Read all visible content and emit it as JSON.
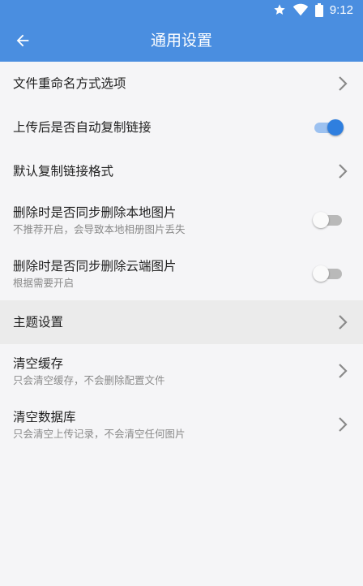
{
  "status_bar": {
    "time": "9:12",
    "icons": [
      "star-icon",
      "wifi-icon",
      "battery-icon"
    ]
  },
  "app_bar": {
    "title": "通用设置",
    "back_icon": "arrow-left-icon"
  },
  "colors": {
    "primary": "#4a8ee0",
    "switch_on": "#2f7fdf",
    "switch_off": "#b9b9b9"
  },
  "settings": {
    "rename_option": {
      "title": "文件重命名方式选项"
    },
    "auto_copy_link": {
      "title": "上传后是否自动复制链接",
      "enabled": true
    },
    "default_link_format": {
      "title": "默认复制链接格式"
    },
    "delete_local_image": {
      "title": "删除时是否同步删除本地图片",
      "subtitle": "不推荐开启，会导致本地相册图片丢失",
      "enabled": false
    },
    "delete_cloud_image": {
      "title": "删除时是否同步删除云端图片",
      "subtitle": "根据需要开启",
      "enabled": false
    },
    "theme": {
      "title": "主题设置"
    },
    "clear_cache": {
      "title": "清空缓存",
      "subtitle": "只会清空缓存，不会删除配置文件"
    },
    "clear_database": {
      "title": "清空数据库",
      "subtitle": "只会清空上传记录，不会清空任何图片"
    }
  }
}
